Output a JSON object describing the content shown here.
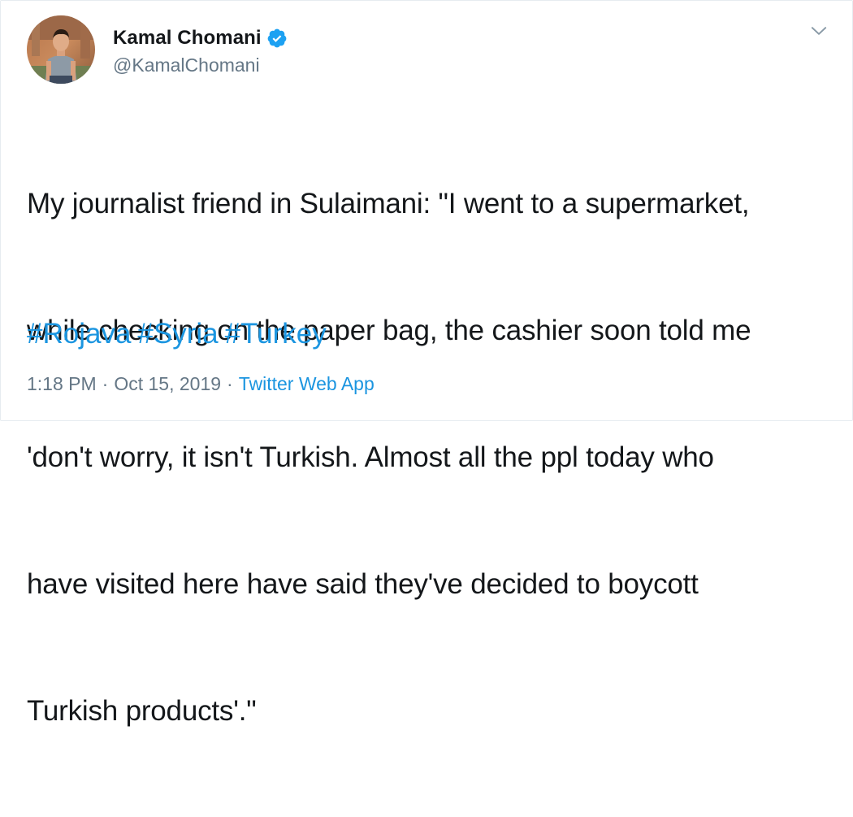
{
  "tweet": {
    "author": {
      "display_name": "Kamal Chomani",
      "handle": "@KamalChomani",
      "verified": true
    },
    "text_lines": [
      "My journalist friend in Sulaimani: \"I went to a supermarket,",
      "while checking on the paper bag, the cashier soon told me",
      "'don't worry, it isn't Turkish. Almost all the ppl today who",
      "have visited here have said they've decided to boycott",
      "Turkish products'.\""
    ],
    "hashtags": [
      "#Rojava",
      "#Syria",
      "#Turkey"
    ],
    "time": "1:18 PM",
    "date": "Oct 15, 2019",
    "source": "Twitter Web App",
    "separator": "·"
  },
  "icons": {
    "verified": "verified-badge-icon",
    "menu": "chevron-down-icon"
  },
  "colors": {
    "link": "#1b95e0",
    "muted": "#657786",
    "text": "#14171a",
    "border": "#e6ecf0"
  }
}
